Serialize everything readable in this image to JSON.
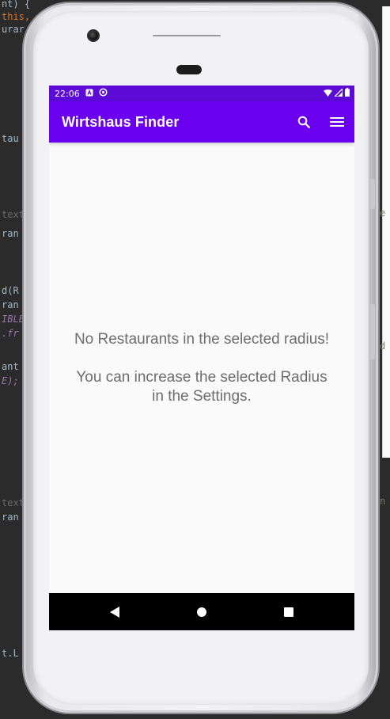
{
  "status_bar": {
    "time": "22:06",
    "notification_icons": [
      "notification-a-icon",
      "sync-icon"
    ],
    "system_icons": [
      "wifi-icon",
      "signal-icon",
      "battery-icon"
    ]
  },
  "app_bar": {
    "title": "Wirtshaus Finder",
    "actions": [
      "search-icon",
      "menu-icon"
    ]
  },
  "empty_state": {
    "message": "No Restaurants in the selected radius!",
    "hint": "You can increase the selected Radius in the Settings."
  },
  "nav_bar": {
    "buttons": [
      "back-icon",
      "home-icon",
      "recents-icon"
    ]
  },
  "background_code": {
    "lines": [
      "nt) {",
      "this,",
      "urar",
      "tau",
      "text",
      "ran",
      "d(R",
      "ran",
      "IBLE",
      ".fr",
      "ant",
      "E);",
      "text",
      "ran",
      "t.L"
    ],
    "right_fragments": [
      "e",
      "d",
      "n"
    ]
  },
  "colors": {
    "status_bar": "#5c0bd6",
    "app_bar": "#6a00ee",
    "screen_bg": "#fafafa",
    "text": "#6d6d6d",
    "nav_bar": "#000000"
  }
}
